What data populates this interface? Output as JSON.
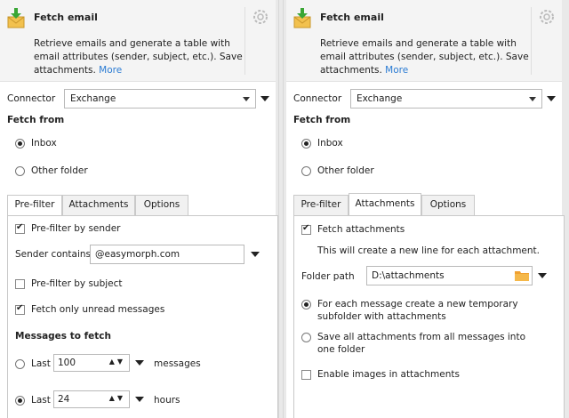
{
  "left": {
    "header": {
      "title": "Fetch email",
      "description": "Retrieve emails and generate a table with email attributes (sender, subject, etc.). Save attachments.",
      "more": "More"
    },
    "connector": {
      "label": "Connector",
      "value": "Exchange"
    },
    "fetch_from": {
      "label": "Fetch from",
      "inbox": "Inbox",
      "other_folder": "Other folder",
      "selected": "inbox"
    },
    "tabs": [
      "Pre-filter",
      "Attachments",
      "Options"
    ],
    "active_tab": "Pre-filter",
    "prefilter": {
      "by_sender_label": "Pre-filter by sender",
      "by_sender_checked": true,
      "sender_contains_label": "Sender contains",
      "sender_contains_value": "@easymorph.com",
      "by_subject_label": "Pre-filter by subject",
      "by_subject_checked": false,
      "unread_label": "Fetch only unread messages",
      "unread_checked": true,
      "messages_to_fetch": "Messages to fetch",
      "last1_label": "Last",
      "last1_value": "100",
      "last1_unit": "messages",
      "last2_label": "Last",
      "last2_value": "24",
      "last2_unit": "hours",
      "selected": "last2"
    }
  },
  "right": {
    "header": {
      "title": "Fetch email",
      "description": "Retrieve emails and generate a table with email attributes (sender, subject, etc.). Save attachments.",
      "more": "More"
    },
    "connector": {
      "label": "Connector",
      "value": "Exchange"
    },
    "fetch_from": {
      "label": "Fetch from",
      "inbox": "Inbox",
      "other_folder": "Other folder",
      "selected": "inbox"
    },
    "tabs": [
      "Pre-filter",
      "Attachments",
      "Options"
    ],
    "active_tab": "Attachments",
    "attachments": {
      "fetch_label": "Fetch attachments",
      "fetch_checked": true,
      "note": "This will create a new line for each attachment.",
      "folder_label": "Folder path",
      "folder_value": "D:\\attachments",
      "option1": "For each message create a new temporary subfolder with attachments",
      "option2": "Save all attachments from all messages into one folder",
      "selected": "option1",
      "images_label": "Enable images in attachments",
      "images_checked": false
    }
  },
  "icons": {
    "header": "download-mail-icon",
    "gear": "gear-icon",
    "folder": "folder-icon"
  },
  "colors": {
    "link": "#2a7bd3",
    "folder": "#f0a030",
    "download": "#3aa635",
    "envelope": "#f2c14e"
  }
}
